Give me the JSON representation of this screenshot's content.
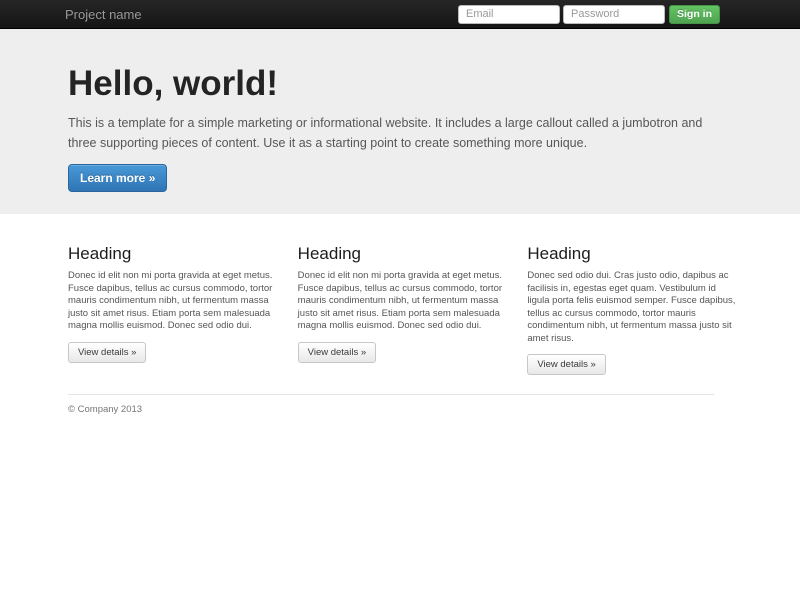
{
  "navbar": {
    "brand": "Project name",
    "email_placeholder": "Email",
    "password_placeholder": "Password",
    "sign_in_label": "Sign in"
  },
  "jumbotron": {
    "title": "Hello, world!",
    "lead": "This is a template for a simple marketing or informational website. It includes a large callout called a jumbotron and three supporting pieces of content. Use it as a starting point to create something more unique.",
    "cta_label": "Learn more »"
  },
  "columns": [
    {
      "heading": "Heading",
      "body": "Donec id elit non mi porta gravida at eget metus. Fusce dapibus, tellus ac cursus commodo, tortor mauris condimentum nibh, ut fermentum massa justo sit amet risus. Etiam porta sem malesuada magna mollis euismod. Donec sed odio dui.",
      "button_label": "View details »"
    },
    {
      "heading": "Heading",
      "body": "Donec id elit non mi porta gravida at eget metus. Fusce dapibus, tellus ac cursus commodo, tortor mauris condimentum nibh, ut fermentum massa justo sit amet risus. Etiam porta sem malesuada magna mollis euismod. Donec sed odio dui.",
      "button_label": "View details »"
    },
    {
      "heading": "Heading",
      "body": "Donec sed odio dui. Cras justo odio, dapibus ac facilisis in, egestas eget quam. Vestibulum id ligula porta felis euismod semper. Fusce dapibus, tellus ac cursus commodo, tortor mauris condimentum nibh, ut fermentum massa justo sit amet risus.",
      "button_label": "View details »"
    }
  ],
  "footer": {
    "copyright": "© Company 2013"
  },
  "colors": {
    "navbar_bg": "#1b1b1b",
    "jumbotron_bg": "#eeeeee",
    "primary_blue": "#3b85c4",
    "success_green": "#5bb75b"
  }
}
